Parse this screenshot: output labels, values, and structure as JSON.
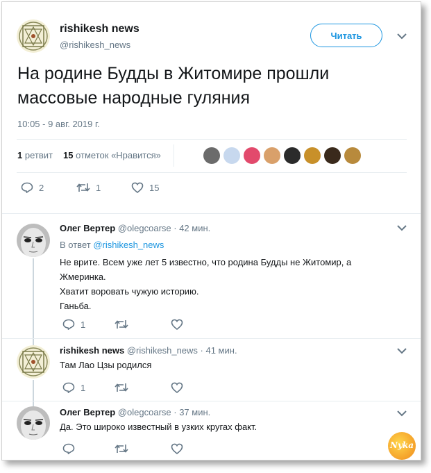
{
  "main_tweet": {
    "author_name": "rishikesh news",
    "author_handle": "@rishikesh_news",
    "follow_label": "Читать",
    "text_line1": "На родине Будды в Житомире прошли",
    "text_line2": "массовые народные гуляния",
    "timestamp": "10:05 - 9 авг. 2019 г.",
    "retweets_count": "1",
    "retweets_label": "ретвит",
    "likes_count": "15",
    "likes_label": "отметок «Нравится»",
    "reply_count": "2",
    "retweet_count": "1",
    "like_count": "15"
  },
  "replies": [
    {
      "author_name": "Олег Вертер",
      "author_handle": "@olegcoarse",
      "time": "· 42 мин.",
      "reply_to_prefix": "В ответ",
      "reply_to_handle": "@rishikesh_news",
      "lines": [
        "Не врите. Всем уже лет 5 известно, что родина Будды не Житомир, а",
        "Жмеринка.",
        "Хватит воровать чужую историю.",
        "Ганьба."
      ],
      "reply_count": "1"
    },
    {
      "author_name": "rishikesh news",
      "author_handle": "@rishikesh_news",
      "time": "· 41 мин.",
      "lines": [
        "Там Лао Цзы родился"
      ],
      "reply_count": "1"
    },
    {
      "author_name": "Олег Вертер",
      "author_handle": "@olegcoarse",
      "time": "· 37 мин.",
      "lines": [
        "Да. Это широко известный в узких кругах факт."
      ]
    }
  ],
  "watermark": "Nyka",
  "colors": {
    "accent": "#1b95e0",
    "muted": "#657786",
    "text": "#14171a"
  }
}
